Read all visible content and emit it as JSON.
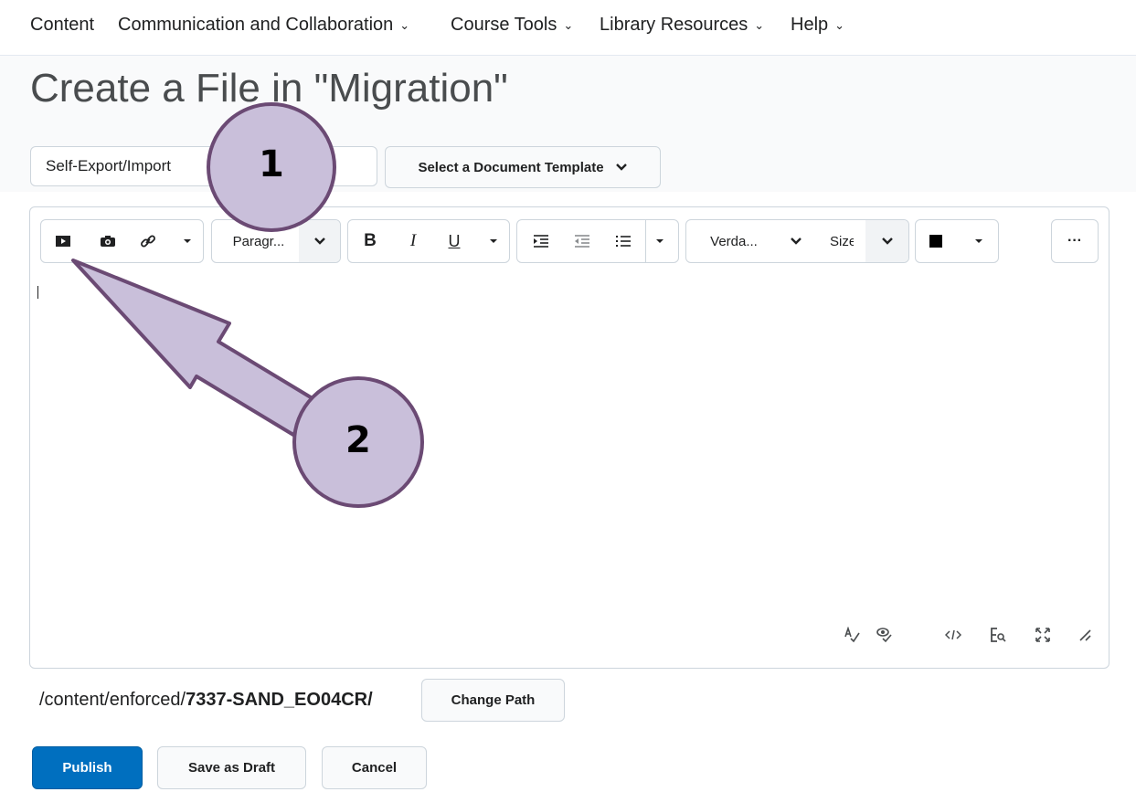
{
  "nav": {
    "items": [
      {
        "label": "Content"
      },
      {
        "label": "Communication and Collaboration"
      },
      {
        "label": "Course Tools"
      },
      {
        "label": "Library Resources"
      },
      {
        "label": "Help"
      }
    ],
    "chevron": "⌄"
  },
  "page": {
    "title": "Create a File in \"Migration\""
  },
  "form": {
    "title_value": "Self-Export/Import",
    "template_button": "Select a Document Template"
  },
  "toolbar": {
    "format_label": "Paragr...",
    "bold": "B",
    "italic": "I",
    "underline": "U",
    "font_label": "Verda...",
    "size_label": "Size",
    "more": "···",
    "icons": [
      "insert-stuff-icon",
      "camera-icon",
      "link-icon",
      "bold-icon",
      "italic-icon",
      "underline-icon",
      "indent-icon",
      "outdent-icon",
      "list-icon",
      "text-color-icon"
    ]
  },
  "editor_footer": {
    "icons": [
      "spellcheck-icon",
      "preview-icon",
      "source-code-icon",
      "find-replace-icon",
      "fullscreen-icon",
      "resize-handle-icon"
    ]
  },
  "path": {
    "prefix": "/content/enforced/",
    "folder": "7337-SAND_EO04CR/",
    "change_button": "Change Path"
  },
  "actions": {
    "publish": "Publish",
    "save_draft": "Save as Draft",
    "cancel": "Cancel"
  },
  "annotations": {
    "callout1": "1",
    "callout2": "2",
    "color": "#c9bfda",
    "stroke": "#6b4a74"
  }
}
